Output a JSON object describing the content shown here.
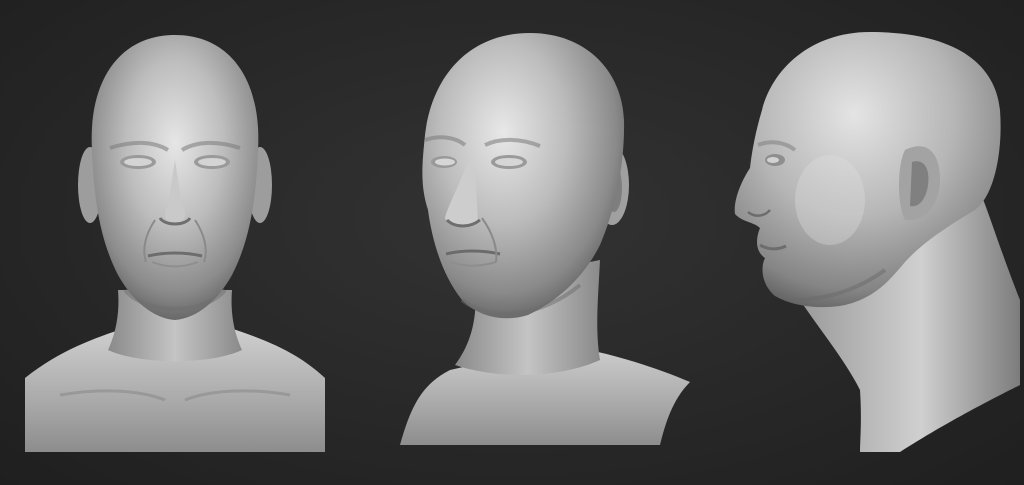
{
  "scene": {
    "background_color": "#262626",
    "clay_color": "#b8b8b8",
    "views": [
      {
        "id": "front",
        "icon": "head-front-view"
      },
      {
        "id": "three-quarter",
        "icon": "head-three-quarter-view"
      },
      {
        "id": "profile",
        "icon": "head-profile-view"
      }
    ]
  }
}
